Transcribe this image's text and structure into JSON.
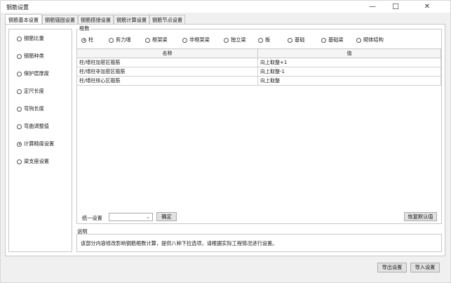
{
  "window": {
    "title": "钢筋设置",
    "minimize": "—",
    "maximize": "☐",
    "close": "✕"
  },
  "tabs": [
    "钢筋基本设置",
    "钢筋锚固设置",
    "钢筋搭接设置",
    "钢筋计算设置",
    "钢筋节点设置"
  ],
  "left_menu": {
    "items": [
      "钢筋比重",
      "钢筋种类",
      "保护层厚度",
      "定尺长度",
      "弯钩长度",
      "弯曲调整值",
      "计算精度设置",
      "梁支座设置"
    ],
    "selected_index": 6
  },
  "root_group": {
    "label": "根数",
    "types": [
      "柱",
      "剪力墙",
      "框架梁",
      "非框架梁",
      "独立梁",
      "板",
      "基础",
      "基础梁",
      "砌体结构"
    ],
    "selected_index": 0
  },
  "grid": {
    "columns": [
      "名称",
      "值"
    ],
    "rows": [
      [
        "柱/墙柱加密区箍筋",
        "向上取整+1"
      ],
      [
        "柱/墙柱非加密区箍筋",
        "向上取整-1"
      ],
      [
        "柱/墙柱核心区箍筋",
        "向上取整"
      ]
    ]
  },
  "unified": {
    "label": "统一设置",
    "value": "",
    "confirm": "确定",
    "restore": "恢复默认值"
  },
  "description": {
    "label": "说明",
    "text": "该部分内容修改影响钢筋根数计算，提供八种下拉选项，请根据实际工程情况进行设置。"
  },
  "footer": {
    "export": "导出设置",
    "import": "导入设置"
  }
}
